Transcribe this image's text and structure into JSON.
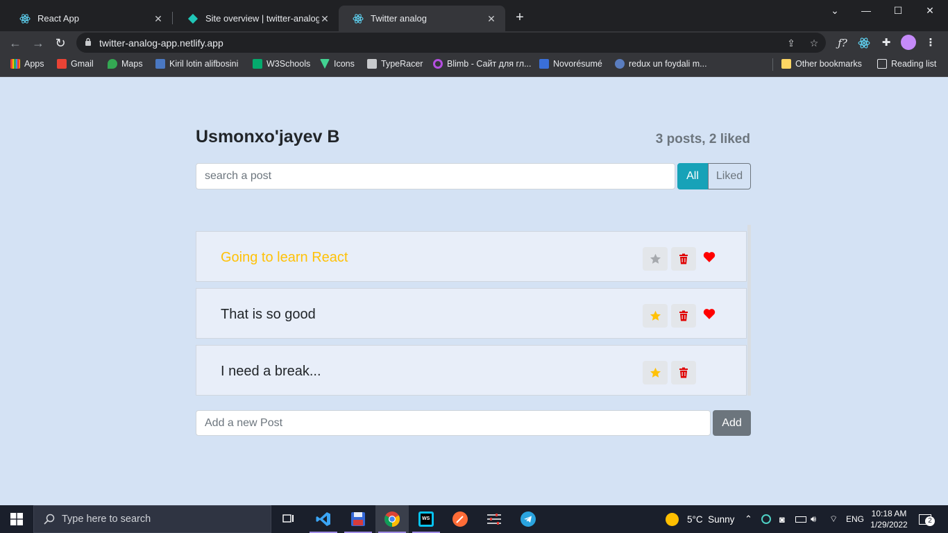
{
  "browser": {
    "tabs": [
      {
        "title": "React App"
      },
      {
        "title": "Site overview | twitter-analog-app"
      },
      {
        "title": "Twitter analog"
      }
    ],
    "url": "twitter-analog-app.netlify.app",
    "bookmarks": [
      {
        "label": "Apps",
        "color": "#ea4335"
      },
      {
        "label": "Gmail",
        "color": "#ea4335"
      },
      {
        "label": "Maps",
        "color": "#34a853"
      },
      {
        "label": "Kiril lotin alifbosini",
        "color": "#4a78c2"
      },
      {
        "label": "W3Schools",
        "color": "#04aa6d"
      },
      {
        "label": "Icons",
        "color": "#42d392"
      },
      {
        "label": "TypeRacer",
        "color": "#c8cacd"
      },
      {
        "label": "Blimb - Сайт для гл...",
        "color": "#b44fe0"
      },
      {
        "label": "Novorésumé",
        "color": "#3a6fd8"
      },
      {
        "label": "redux un foydali m...",
        "color": "#5a7dbf"
      }
    ],
    "other_bookmarks": "Other bookmarks",
    "reading_list": "Reading list"
  },
  "app": {
    "title": "Usmonxo'jayev B",
    "stats": "3 posts, 2 liked",
    "search_placeholder": "search a post",
    "filter_all": "All",
    "filter_liked": "Liked",
    "posts": [
      {
        "text": "Going to learn React",
        "important": true,
        "liked": true
      },
      {
        "text": "That is so good",
        "important": false,
        "liked": true
      },
      {
        "text": "I need a break...",
        "important": false,
        "liked": false
      }
    ],
    "add_placeholder": "Add a new Post",
    "add_label": "Add"
  },
  "colors": {
    "accent": "#17a2b8",
    "important": "#ffc107",
    "danger": "#dc3545",
    "heart": "#ff0000",
    "page_bg": "#d4e2f4"
  },
  "taskbar": {
    "search_placeholder": "Type here to search",
    "weather": "5°C  Sunny",
    "language": "ENG",
    "time": "10:18 AM",
    "date": "1/29/2022",
    "notifications": "2"
  }
}
